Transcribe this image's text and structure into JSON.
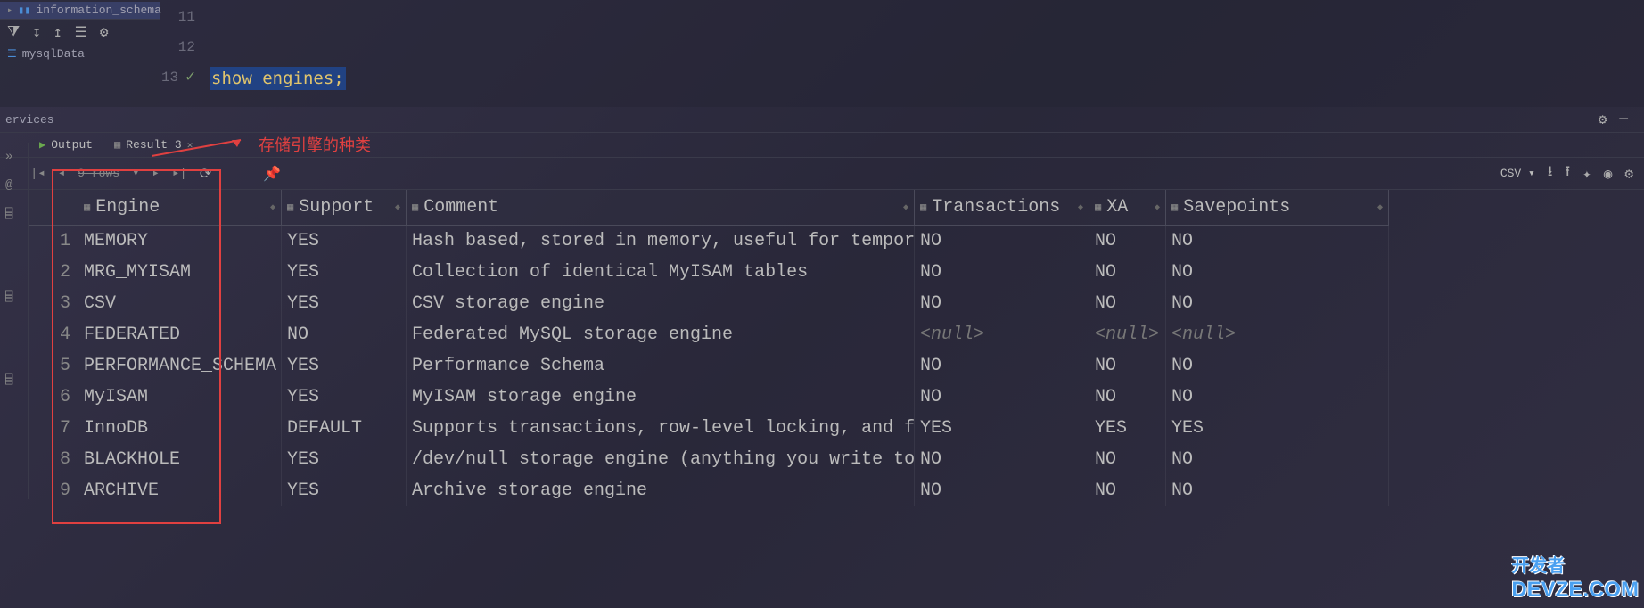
{
  "tree": {
    "item1": "information_schema"
  },
  "sidebar_tab": "mysqlData",
  "editor": {
    "lines": {
      "11": "11",
      "12": "12",
      "13": "13"
    },
    "sql": "show engines;"
  },
  "services_label": "ervices",
  "tabs": {
    "output": "Output",
    "result": "Result 3"
  },
  "annotation": "存储引擎的种类",
  "controls": {
    "row_count": "9 rows",
    "dropdown": "CSV"
  },
  "table": {
    "columns": [
      "Engine",
      "Support",
      "Comment",
      "Transactions",
      "XA",
      "Savepoints"
    ],
    "rows": [
      {
        "n": "1",
        "engine": "MEMORY",
        "support": "YES",
        "comment": "Hash based, stored in memory, useful for tempor…",
        "tx": "NO",
        "xa": "NO",
        "sp": "NO"
      },
      {
        "n": "2",
        "engine": "MRG_MYISAM",
        "support": "YES",
        "comment": "Collection of identical MyISAM tables",
        "tx": "NO",
        "xa": "NO",
        "sp": "NO"
      },
      {
        "n": "3",
        "engine": "CSV",
        "support": "YES",
        "comment": "CSV storage engine",
        "tx": "NO",
        "xa": "NO",
        "sp": "NO"
      },
      {
        "n": "4",
        "engine": "FEDERATED",
        "support": "NO",
        "comment": "Federated MySQL storage engine",
        "tx": "<null>",
        "xa": "<null>",
        "sp": "<null>"
      },
      {
        "n": "5",
        "engine": "PERFORMANCE_SCHEMA",
        "support": "YES",
        "comment": "Performance Schema",
        "tx": "NO",
        "xa": "NO",
        "sp": "NO"
      },
      {
        "n": "6",
        "engine": "MyISAM",
        "support": "YES",
        "comment": "MyISAM storage engine",
        "tx": "NO",
        "xa": "NO",
        "sp": "NO"
      },
      {
        "n": "7",
        "engine": "InnoDB",
        "support": "DEFAULT",
        "comment": "Supports transactions, row-level locking, and f…",
        "tx": "YES",
        "xa": "YES",
        "sp": "YES"
      },
      {
        "n": "8",
        "engine": "BLACKHOLE",
        "support": "YES",
        "comment": "/dev/null storage engine (anything you write to…",
        "tx": "NO",
        "xa": "NO",
        "sp": "NO"
      },
      {
        "n": "9",
        "engine": "ARCHIVE",
        "support": "YES",
        "comment": "Archive storage engine",
        "tx": "NO",
        "xa": "NO",
        "sp": "NO"
      }
    ]
  },
  "watermark": {
    "cn": "开发者",
    "en": "DEVZE.COM"
  }
}
